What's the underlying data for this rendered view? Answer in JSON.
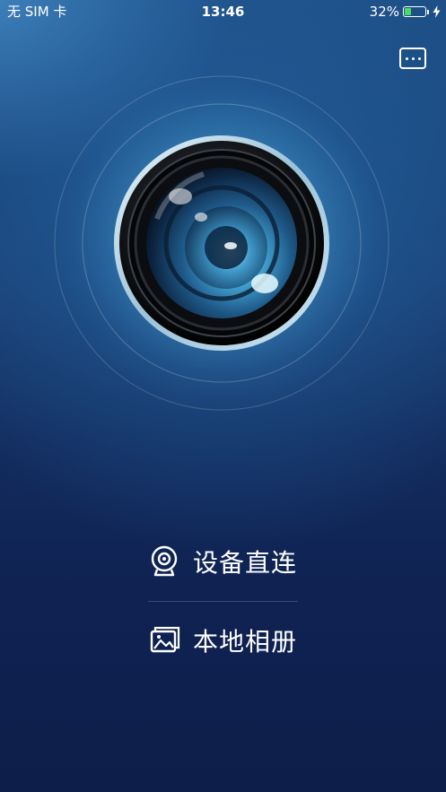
{
  "status_bar": {
    "carrier": "无 SIM 卡",
    "time": "13:46",
    "battery_percent": "32%",
    "battery_level": 0.32,
    "battery_color": "#4cd964",
    "charging_icon": "bolt-icon"
  },
  "header": {
    "more_icon": "more-horizontal-icon"
  },
  "hero": {
    "image": "camera-lens-illustration"
  },
  "menu": {
    "items": [
      {
        "label": "设备直连",
        "icon": "webcam-icon"
      },
      {
        "label": "本地相册",
        "icon": "photo-album-icon"
      }
    ]
  },
  "colors": {
    "background_top": "#1e4f86",
    "background_bottom": "#0d1e4a",
    "text": "#ffffff"
  }
}
